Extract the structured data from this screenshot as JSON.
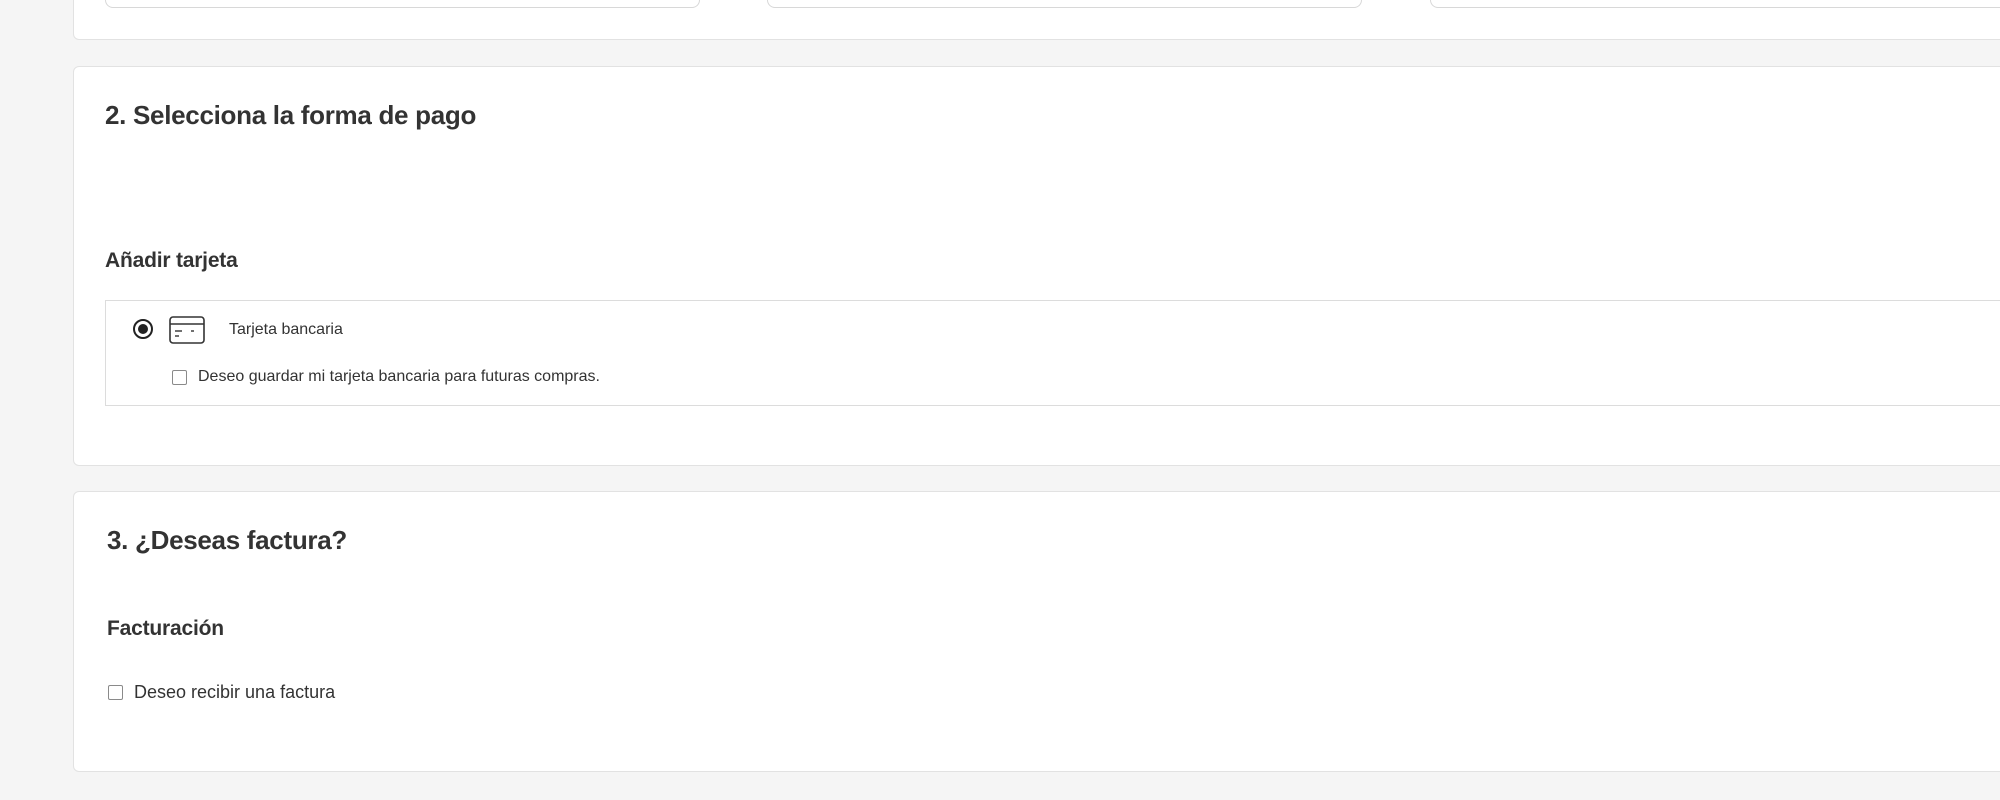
{
  "payment_section": {
    "title": "2. Selecciona la forma de pago",
    "add_card_heading": "Añadir tarjeta",
    "option": {
      "icon": "credit-card-icon",
      "label": "Tarjeta bancaria",
      "selected": true
    },
    "save_card": {
      "label": "Deseo guardar mi tarjeta bancaria para futuras compras.",
      "checked": false
    }
  },
  "invoice_section": {
    "title": "3. ¿Deseas factura?",
    "billing_heading": "Facturación",
    "want_invoice": {
      "label": "Deseo recibir una factura",
      "checked": false
    }
  },
  "colors": {
    "background": "#f5f5f5",
    "card": "#ffffff",
    "border": "#e2e2e2",
    "text": "#333333"
  }
}
